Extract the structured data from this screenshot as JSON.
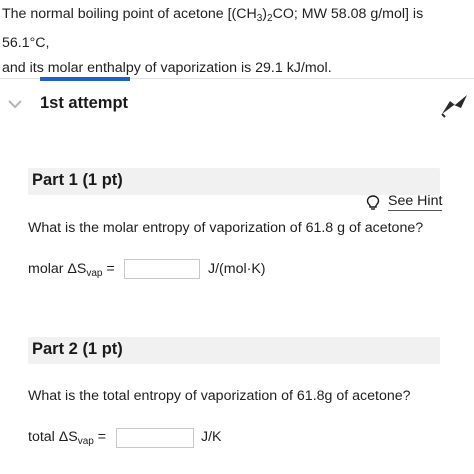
{
  "problem": {
    "intro_a": "The normal boiling point of acetone [(CH",
    "sub3": "3",
    "intro_b": ")",
    "sub2": "2",
    "intro_c": "CO; MW 58.08 g/mol] is 56.1°C,",
    "line2": "and its molar enthalpy of vaporization is 29.1 kJ/mol."
  },
  "attempt": {
    "label": "1st attempt"
  },
  "part1": {
    "title": "Part 1 (1 pt)",
    "hint_label": "See Hint",
    "question": "What is the molar entropy of vaporization of 61.8 g of acetone?",
    "answer_label_pre": "molar ΔS",
    "answer_label_sub": "vap",
    "answer_label_post": " =",
    "answer_value": "",
    "unit": "J/(mol·K)"
  },
  "part2": {
    "title": "Part 2 (1 pt)",
    "question": "What is the total entropy of vaporization of 61.8g of acetone?",
    "answer_label_pre": "total ΔS",
    "answer_label_sub": "vap",
    "answer_label_post": " =",
    "answer_value": "",
    "unit": "J/K"
  },
  "colors": {
    "accent": "#1f5fc6",
    "header_bg": "#f1f1f1"
  },
  "icons": {
    "collapse": "chevron-down-icon",
    "hint": "lightbulb-icon",
    "flag": "flag-icon"
  }
}
